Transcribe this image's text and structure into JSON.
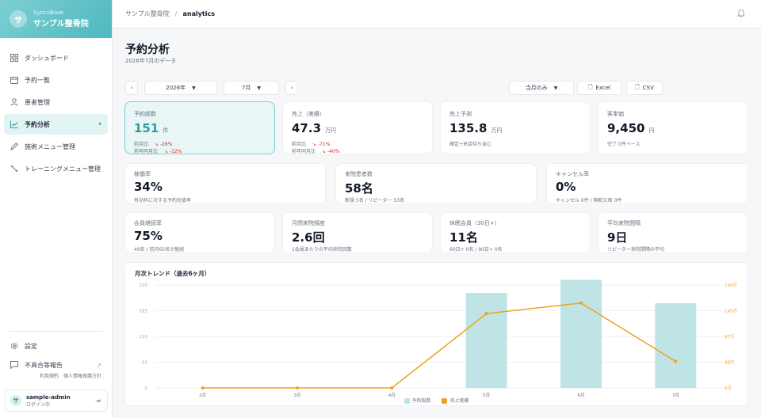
{
  "brand": {
    "logo_char": "サ",
    "sub": "SyncoBase",
    "name": "サンプル整骨院"
  },
  "nav": [
    {
      "label": "ダッシュボード",
      "icon": "grid-icon"
    },
    {
      "label": "予約一覧",
      "icon": "calendar-icon"
    },
    {
      "label": "患者管理",
      "icon": "user-icon"
    },
    {
      "label": "予約分析",
      "icon": "chart-icon",
      "active": true
    },
    {
      "label": "施術メニュー管理",
      "icon": "pen-icon"
    },
    {
      "label": "トレーニングメニュー管理",
      "icon": "dumbbell-icon"
    }
  ],
  "side_bottom": {
    "settings": "設定",
    "report": "不具合等報告",
    "terms": "利用規約",
    "privacy": "個人情報保護方針"
  },
  "user": {
    "avatar": "サ",
    "name": "sample-admin",
    "status": "ログイン中"
  },
  "breadcrumb": {
    "root": "サンプル整骨院",
    "current": "analytics"
  },
  "page": {
    "title": "予約分析",
    "subtitle": "2026年7月のデータ"
  },
  "controls": {
    "prev": "‹",
    "next": "›",
    "year": "2026年",
    "month": "7月",
    "range": "当月のみ",
    "excel": "Excel",
    "csv": "CSV"
  },
  "kpi_row1": [
    {
      "label": "予約総数",
      "value": "151",
      "unit": "件",
      "sub1": "前月比",
      "sub1_delta": "↘ -26%",
      "sub2": "前年同月比",
      "sub2_delta": "↘ -12%",
      "highlight": true
    },
    {
      "label": "売上（実績）",
      "value": "47.3",
      "unit": "万円",
      "sub1": "前月比",
      "sub1_delta": "↘ -71%",
      "sub2": "前年同月比",
      "sub2_delta": "↘ -40%"
    },
    {
      "label": "売上予測",
      "value": "135.8",
      "unit": "万円",
      "sub1": "確定+来店待ち含む"
    },
    {
      "label": "客単価",
      "value": "9,450",
      "unit": "円",
      "sub1": "完了 0件ベース"
    }
  ],
  "kpi_row2": [
    {
      "label": "稼働率",
      "value": "34%",
      "sub1": "有効枠に対する予約充填率"
    },
    {
      "label": "来院患者数",
      "value": "58名",
      "sub1": "新規 5名 / リピーター 53名"
    },
    {
      "label": "キャンセル率",
      "value": "0%",
      "sub1": "キャンセル 0件 / 無断欠席 0件"
    }
  ],
  "kpi_row3": [
    {
      "label": "会員継続率",
      "value": "75%",
      "sub1": "49名 / 前月65名が継続"
    },
    {
      "label": "月間来院頻度",
      "value": "2.6回",
      "sub1": "1会員あたりの平均来院回数"
    },
    {
      "label": "休眠会員（30日+）",
      "value": "11名",
      "sub1": "60日+ 0名 / 90日+ 0名"
    },
    {
      "label": "平均来院間隔",
      "value": "9日",
      "sub1": "リピーター来院間隔の平均"
    }
  ],
  "chart_data": {
    "type": "bar",
    "title": "月次トレンド（過去6ヶ月）",
    "categories": [
      "2月",
      "3月",
      "4月",
      "5月",
      "6月",
      "7月"
    ],
    "left_axis": {
      "ticks": [
        "0",
        "55",
        "110",
        "165",
        "220"
      ],
      "ylim": [
        0,
        220
      ]
    },
    "right_axis": {
      "ticks": [
        "0万",
        "48万",
        "97万",
        "145万",
        "194万"
      ],
      "ylim": [
        0,
        194
      ]
    },
    "series": [
      {
        "name": "予約総数",
        "type": "bar",
        "axis": "left",
        "color": "#bfe4e6",
        "values": [
          0,
          0,
          0,
          203,
          231,
          181
        ]
      },
      {
        "name": "売上実績",
        "type": "line",
        "axis": "right",
        "color": "#f0a020",
        "values": [
          0,
          0,
          0,
          140,
          160,
          50
        ]
      }
    ],
    "legend": "bottom",
    "grid": true
  }
}
